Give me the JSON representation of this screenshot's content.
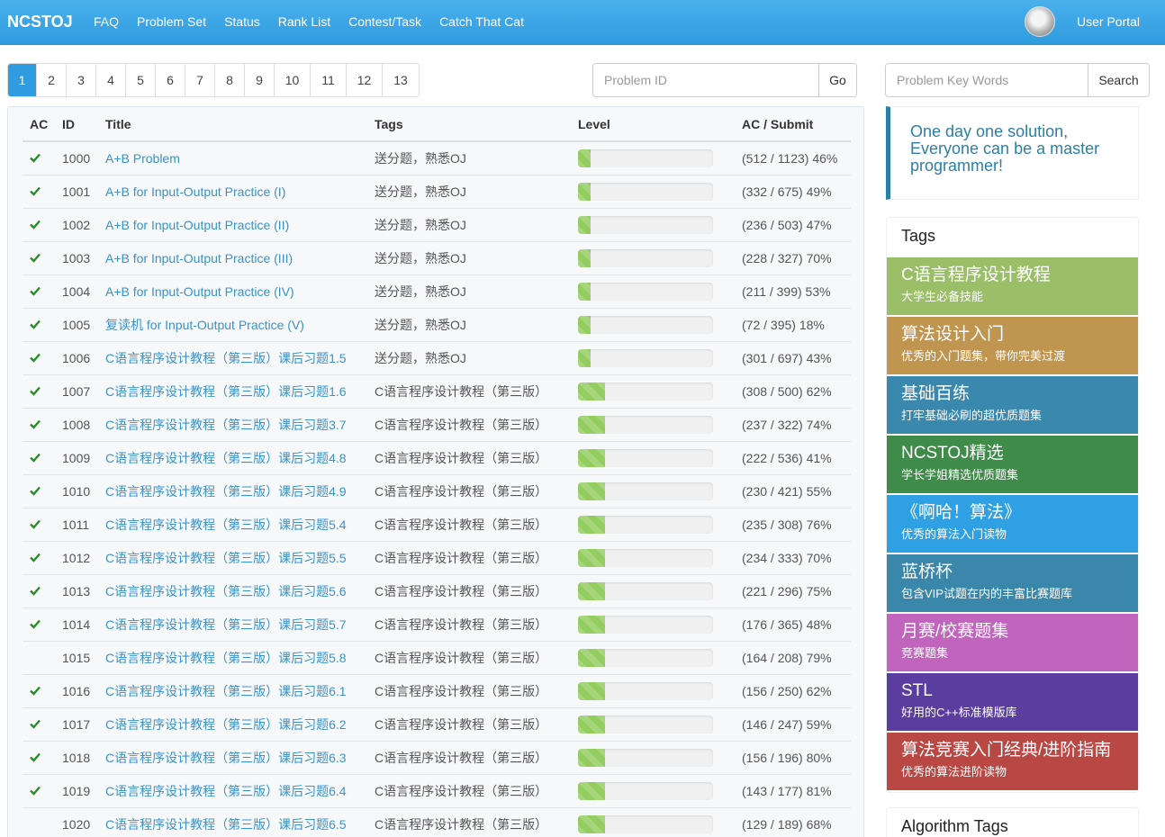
{
  "nav": {
    "brand": "NCSTOJ",
    "links": [
      "FAQ",
      "Problem Set",
      "Status",
      "Rank List",
      "Contest/Task",
      "Catch That Cat"
    ],
    "user_portal": "User Portal"
  },
  "pagination": {
    "pages": [
      "1",
      "2",
      "3",
      "4",
      "5",
      "6",
      "7",
      "8",
      "9",
      "10",
      "11",
      "12",
      "13"
    ],
    "active": "1"
  },
  "search_id": {
    "placeholder": "Problem ID",
    "button": "Go"
  },
  "search_keywords": {
    "placeholder": "Problem Key Words",
    "button": "Search"
  },
  "table": {
    "headers": [
      "AC",
      "ID",
      "Title",
      "Tags",
      "Level",
      "AC / Submit"
    ],
    "rows": [
      {
        "ac": true,
        "id": "1000",
        "title": "A+B Problem",
        "tags": "送分题，熟悉OJ",
        "level": 0.09,
        "stats": "(512 / 1123) 46%"
      },
      {
        "ac": true,
        "id": "1001",
        "title": "A+B for Input-Output Practice (I)",
        "tags": "送分题，熟悉OJ",
        "level": 0.09,
        "stats": "(332 / 675) 49%"
      },
      {
        "ac": true,
        "id": "1002",
        "title": "A+B for Input-Output Practice (II)",
        "tags": "送分题，熟悉OJ",
        "level": 0.09,
        "stats": "(236 / 503) 47%"
      },
      {
        "ac": true,
        "id": "1003",
        "title": "A+B for Input-Output Practice (III)",
        "tags": "送分题，熟悉OJ",
        "level": 0.09,
        "stats": "(228 / 327) 70%"
      },
      {
        "ac": true,
        "id": "1004",
        "title": "A+B for Input-Output Practice (IV)",
        "tags": "送分题，熟悉OJ",
        "level": 0.09,
        "stats": "(211 / 399) 53%"
      },
      {
        "ac": true,
        "id": "1005",
        "title": "复读机 for Input-Output Practice (V)",
        "tags": "送分题，熟悉OJ",
        "level": 0.09,
        "stats": "(72 / 395) 18%"
      },
      {
        "ac": true,
        "id": "1006",
        "title": "C语言程序设计教程（第三版）课后习题1.5",
        "tags": "送分题，熟悉OJ",
        "level": 0.09,
        "stats": "(301 / 697) 43%"
      },
      {
        "ac": true,
        "id": "1007",
        "title": "C语言程序设计教程（第三版）课后习题1.6",
        "tags": "C语言程序设计教程（第三版）",
        "level": 0.2,
        "stats": "(308 / 500) 62%"
      },
      {
        "ac": true,
        "id": "1008",
        "title": "C语言程序设计教程（第三版）课后习题3.7",
        "tags": "C语言程序设计教程（第三版）",
        "level": 0.2,
        "stats": "(237 / 322) 74%"
      },
      {
        "ac": true,
        "id": "1009",
        "title": "C语言程序设计教程（第三版）课后习题4.8",
        "tags": "C语言程序设计教程（第三版）",
        "level": 0.2,
        "stats": "(222 / 536) 41%"
      },
      {
        "ac": true,
        "id": "1010",
        "title": "C语言程序设计教程（第三版）课后习题4.9",
        "tags": "C语言程序设计教程（第三版）",
        "level": 0.2,
        "stats": "(230 / 421) 55%"
      },
      {
        "ac": true,
        "id": "1011",
        "title": "C语言程序设计教程（第三版）课后习题5.4",
        "tags": "C语言程序设计教程（第三版）",
        "level": 0.2,
        "stats": "(235 / 308) 76%"
      },
      {
        "ac": true,
        "id": "1012",
        "title": "C语言程序设计教程（第三版）课后习题5.5",
        "tags": "C语言程序设计教程（第三版）",
        "level": 0.2,
        "stats": "(234 / 333) 70%"
      },
      {
        "ac": true,
        "id": "1013",
        "title": "C语言程序设计教程（第三版）课后习题5.6",
        "tags": "C语言程序设计教程（第三版）",
        "level": 0.2,
        "stats": "(221 / 296) 75%"
      },
      {
        "ac": true,
        "id": "1014",
        "title": "C语言程序设计教程（第三版）课后习题5.7",
        "tags": "C语言程序设计教程（第三版）",
        "level": 0.2,
        "stats": "(176 / 365) 48%"
      },
      {
        "ac": false,
        "id": "1015",
        "title": "C语言程序设计教程（第三版）课后习题5.8",
        "tags": "C语言程序设计教程（第三版）",
        "level": 0.2,
        "stats": "(164 / 208) 79%"
      },
      {
        "ac": true,
        "id": "1016",
        "title": "C语言程序设计教程（第三版）课后习题6.1",
        "tags": "C语言程序设计教程（第三版）",
        "level": 0.2,
        "stats": "(156 / 250) 62%"
      },
      {
        "ac": true,
        "id": "1017",
        "title": "C语言程序设计教程（第三版）课后习题6.2",
        "tags": "C语言程序设计教程（第三版）",
        "level": 0.2,
        "stats": "(146 / 247) 59%"
      },
      {
        "ac": true,
        "id": "1018",
        "title": "C语言程序设计教程（第三版）课后习题6.3",
        "tags": "C语言程序设计教程（第三版）",
        "level": 0.2,
        "stats": "(156 / 196) 80%"
      },
      {
        "ac": true,
        "id": "1019",
        "title": "C语言程序设计教程（第三版）课后习题6.4",
        "tags": "C语言程序设计教程（第三版）",
        "level": 0.2,
        "stats": "(143 / 177) 81%"
      },
      {
        "ac": false,
        "id": "1020",
        "title": "C语言程序设计教程（第三版）课后习题6.5",
        "tags": "C语言程序设计教程（第三版）",
        "level": 0.2,
        "stats": "(129 / 189) 68%"
      }
    ]
  },
  "motto": {
    "line1": "One day one solution,",
    "line2": "Everyone can be a master",
    "line3": "programmer!"
  },
  "tags_panel": {
    "heading": "Tags",
    "items": [
      {
        "title": "C语言程序设计教程",
        "subtitle": "大学生必备技能",
        "color": "#9bbf68"
      },
      {
        "title": "算法设计入门",
        "subtitle": "优秀的入门题集，带你完美过渡",
        "color": "#c0954f"
      },
      {
        "title": "基础百练",
        "subtitle": "打牢基础必刷的超优质题集",
        "color": "#3a88ad"
      },
      {
        "title": "NCSTOJ精选",
        "subtitle": "学长学姐精选优质题集",
        "color": "#3f8b4a"
      },
      {
        "title": "《啊哈！算法》",
        "subtitle": "优秀的算法入门读物",
        "color": "#2ea0e3"
      },
      {
        "title": "蓝桥杯",
        "subtitle": "包含VIP试题在内的丰富比赛题库",
        "color": "#3a87ab"
      },
      {
        "title": "月赛/校赛题集",
        "subtitle": "竞赛题集",
        "color": "#c064bd"
      },
      {
        "title": "STL",
        "subtitle": "好用的C++标准模版库",
        "color": "#5a3d9e"
      },
      {
        "title": "算法竞赛入门经典/进阶指南",
        "subtitle": "优秀的算法进阶读物",
        "color": "#b94845"
      }
    ]
  },
  "algo_panel": {
    "heading": "Algorithm Tags"
  }
}
